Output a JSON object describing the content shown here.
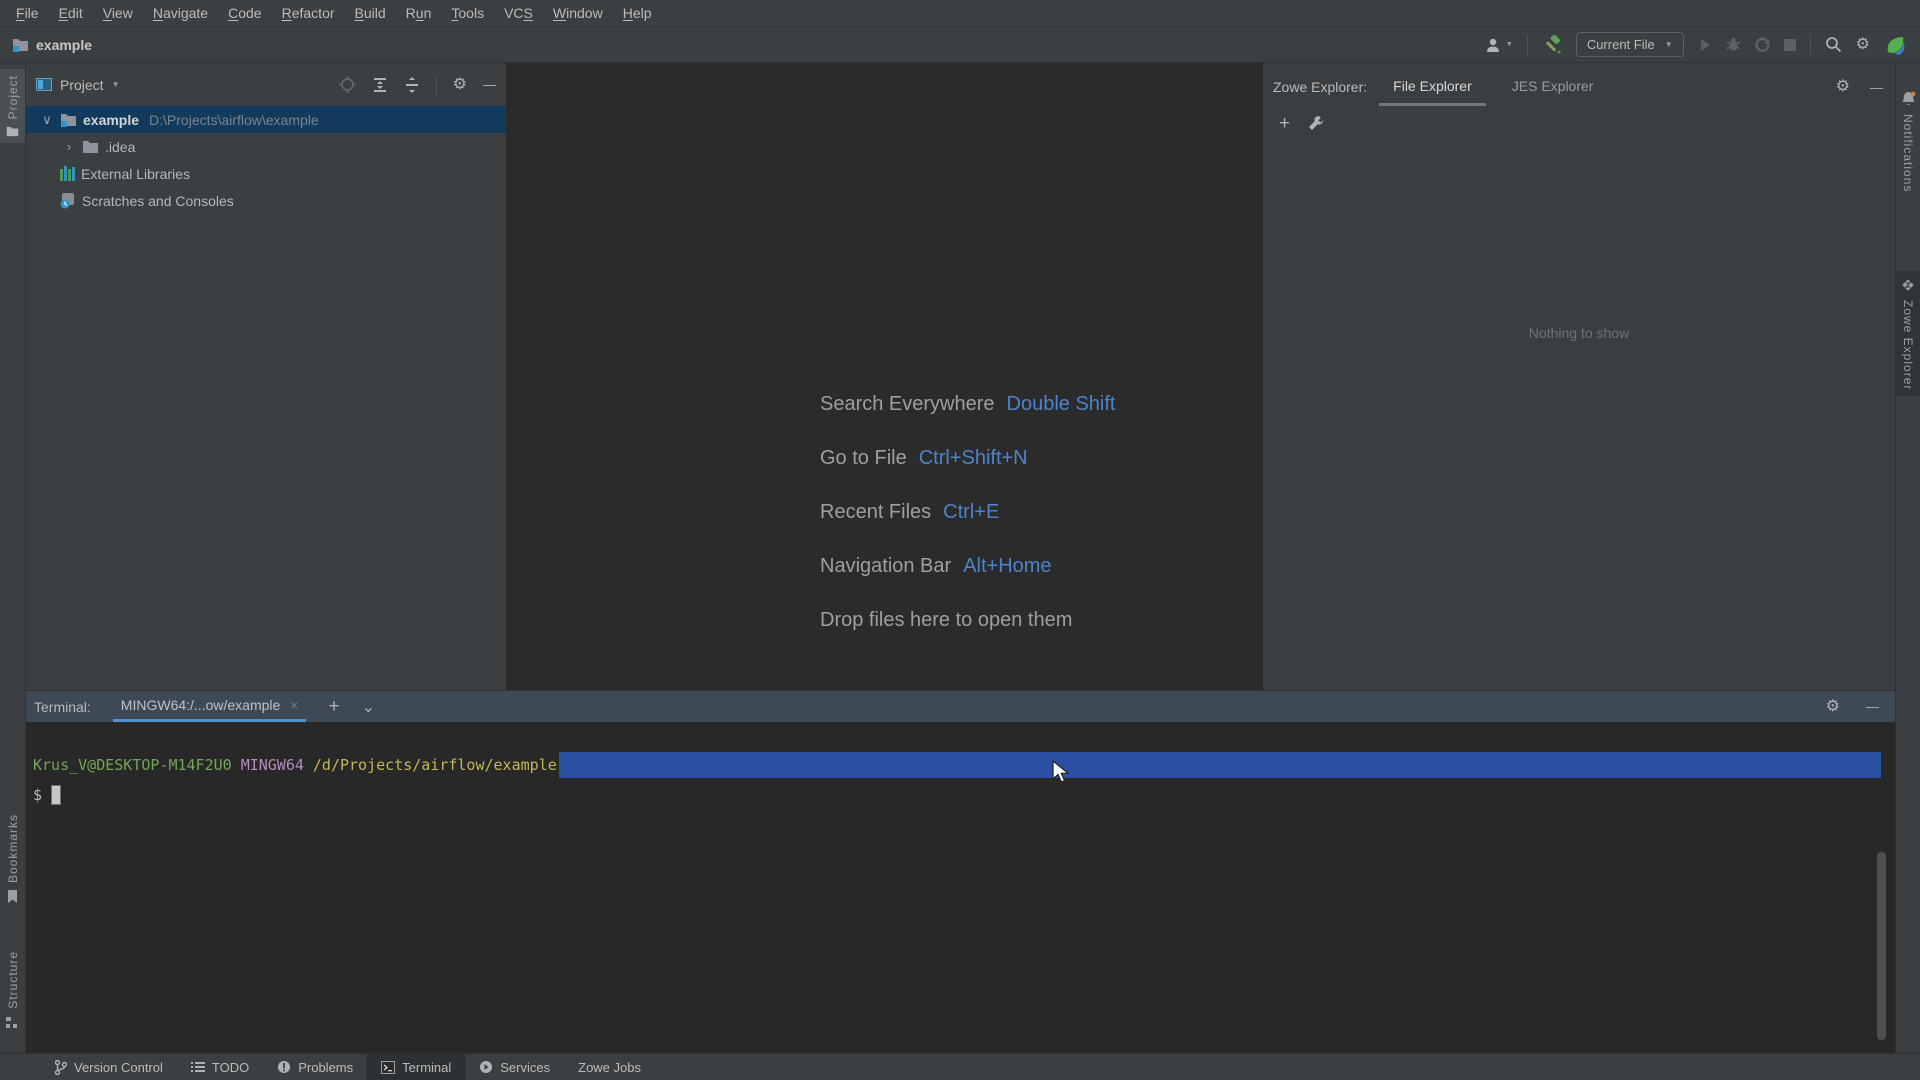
{
  "colors": {
    "panel_bg": "#3C3F41",
    "editor_bg": "#2B2B2B",
    "accent_blue": "#4E83C9",
    "selection_blue": "#2B4FA1",
    "tab_underline_blue": "#4E94CE",
    "selected_row": "#113A5C",
    "prompt_green": "#73A657",
    "prompt_purple": "#B48BC2",
    "prompt_yellow": "#C4B656"
  },
  "menu_bar": {
    "items": [
      {
        "label": "File",
        "mnemonic": 0
      },
      {
        "label": "Edit",
        "mnemonic": 0
      },
      {
        "label": "View",
        "mnemonic": 0
      },
      {
        "label": "Navigate",
        "mnemonic": 0
      },
      {
        "label": "Code",
        "mnemonic": 0
      },
      {
        "label": "Refactor",
        "mnemonic": 0
      },
      {
        "label": "Build",
        "mnemonic": 0
      },
      {
        "label": "Run",
        "mnemonic": 1
      },
      {
        "label": "Tools",
        "mnemonic": 0
      },
      {
        "label": "VCS",
        "mnemonic": 2
      },
      {
        "label": "Window",
        "mnemonic": 0
      },
      {
        "label": "Help",
        "mnemonic": 0
      }
    ]
  },
  "toolbar": {
    "project_name": "example",
    "run_config": "Current File"
  },
  "left_stripe": {
    "project": "Project",
    "bookmarks": "Bookmarks",
    "structure": "Structure"
  },
  "right_stripe": {
    "notifications": "Notifications",
    "zowe_explorer": "Zowe Explorer"
  },
  "project_panel": {
    "title": "Project",
    "tree": [
      {
        "name": "example",
        "path": "D:\\Projects\\airflow\\example"
      },
      {
        "name": ".idea"
      },
      {
        "name": "External Libraries"
      },
      {
        "name": "Scratches and Consoles"
      }
    ]
  },
  "editor": {
    "shortcuts": [
      {
        "label": "Search Everywhere",
        "keys": "Double Shift"
      },
      {
        "label": "Go to File",
        "keys": "Ctrl+Shift+N"
      },
      {
        "label": "Recent Files",
        "keys": "Ctrl+E"
      },
      {
        "label": "Navigation Bar",
        "keys": "Alt+Home"
      },
      {
        "label": "Drop files here to open them",
        "keys": ""
      }
    ]
  },
  "zowe_panel": {
    "title": "Zowe Explorer:",
    "tabs": [
      "File Explorer",
      "JES Explorer"
    ],
    "empty_text": "Nothing to show"
  },
  "terminal": {
    "label": "Terminal:",
    "tab": "MINGW64:/...ow/example",
    "prompt_user": "Krus_V@DESKTOP-M14F2U0",
    "prompt_env": "MINGW64",
    "prompt_path": "/d/Projects/airflow/example",
    "prompt_symbol": "$"
  },
  "bottom_bar": {
    "items": [
      "Version Control",
      "TODO",
      "Problems",
      "Terminal",
      "Services",
      "Zowe Jobs"
    ],
    "active": "Terminal"
  },
  "icons": {
    "gear": "⚙",
    "minus": "—",
    "plus": "+",
    "close": "×",
    "chevron_down": "⌄",
    "dropdown": "▼",
    "tree_expanded": "∨",
    "tree_collapsed": "›"
  }
}
